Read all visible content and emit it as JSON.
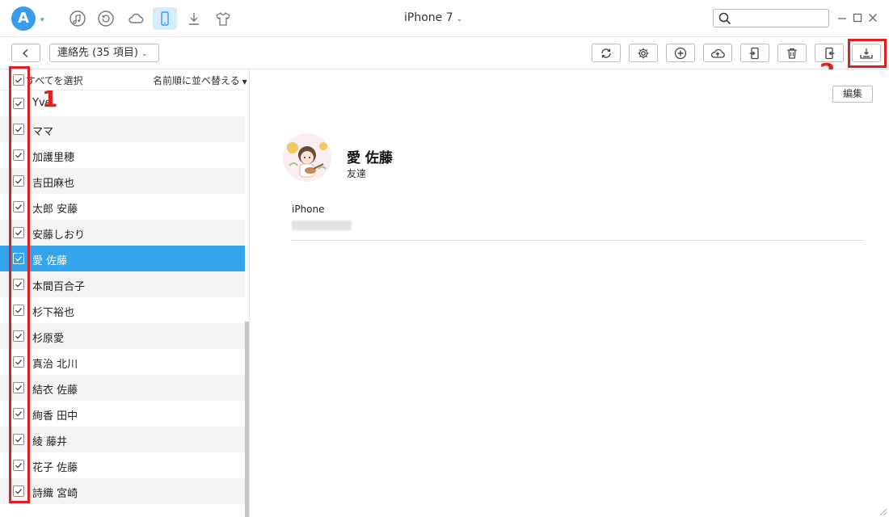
{
  "app": {
    "device_title": "iPhone 7",
    "search": {
      "placeholder": ""
    }
  },
  "title_icons": [
    "music-note-icon",
    "history-icon",
    "cloud-icon",
    "iphone-icon",
    "download-icon",
    "tshirt-icon"
  ],
  "toolbar": {
    "category_label": "連絡先 (35 項目)",
    "tool_icons": [
      "refresh-icon",
      "settings-gear-icon",
      "add-icon",
      "upload-cloud-icon",
      "export-to-device-icon",
      "delete-trash-icon",
      "import-icon",
      "export-to-pc-icon"
    ]
  },
  "annotations": {
    "step1": "1",
    "step2": "2"
  },
  "list": {
    "select_all_label": "すべてを選択",
    "sort_label": "名前順に並べ替える",
    "contacts": [
      {
        "name": "Yve"
      },
      {
        "name": "ママ"
      },
      {
        "name": "加護里穂"
      },
      {
        "name": "吉田麻也"
      },
      {
        "name": "太郎 安藤"
      },
      {
        "name": "安藤しおり"
      },
      {
        "name": "愛 佐藤"
      },
      {
        "name": "本間百合子"
      },
      {
        "name": "杉下裕也"
      },
      {
        "name": "杉原愛"
      },
      {
        "name": "真治 北川"
      },
      {
        "name": "結衣 佐藤"
      },
      {
        "name": "絢香 田中"
      },
      {
        "name": "綾 藤井"
      },
      {
        "name": "花子 佐藤"
      },
      {
        "name": "詩織 宮崎"
      }
    ],
    "selected_index": 6
  },
  "detail": {
    "edit_label": "編集",
    "name": "愛 佐藤",
    "group": "友達",
    "phone_label": "iPhone"
  },
  "colors": {
    "accent": "#36a4ec",
    "annotation_red": "#e02020"
  }
}
